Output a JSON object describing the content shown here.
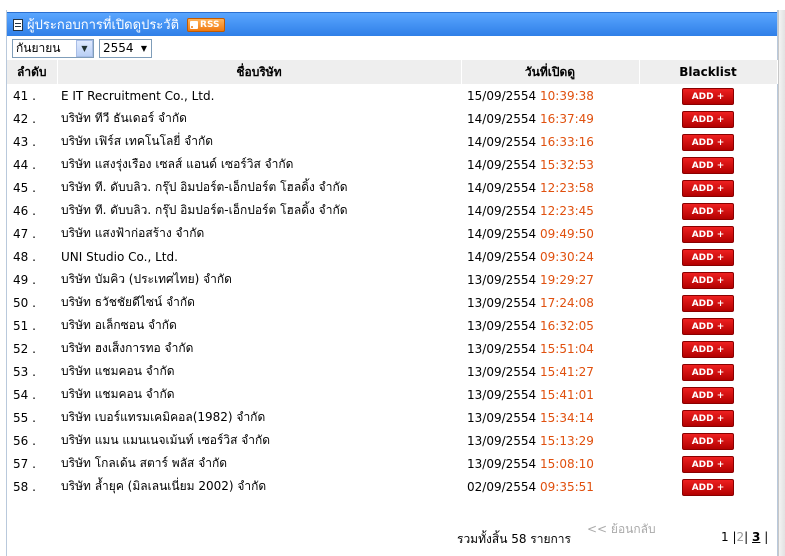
{
  "header": {
    "title": "ผู้ประกอบการที่เปิดดูประวัติ",
    "rss_label": "RSS"
  },
  "filters": {
    "month": "กันยายน",
    "year": "2554"
  },
  "table": {
    "columns": [
      "ลำดับ",
      "ชื่อบริษัท",
      "วันที่เปิดดู",
      "Blacklist"
    ],
    "add_label": "ADD +",
    "rows": [
      {
        "no": "41 .",
        "company": "E IT Recruitment Co., Ltd.",
        "date": "15/09/2554",
        "time": "10:39:38"
      },
      {
        "no": "42 .",
        "company": "บริษัท ทีวี ธันเดอร์ จำกัด",
        "date": "14/09/2554",
        "time": "16:37:49"
      },
      {
        "no": "43 .",
        "company": "บริษัท เฟิร์ส เทคโนโลยี่ จำกัด",
        "date": "14/09/2554",
        "time": "16:33:16"
      },
      {
        "no": "44 .",
        "company": "บริษัท แสงรุ่งเรือง เซลส์ แอนด์ เซอร์วิส จำกัด",
        "date": "14/09/2554",
        "time": "15:32:53"
      },
      {
        "no": "45 .",
        "company": "บริษัท ที. ดับบลิว. กรุ๊ป อิมปอร์ต-เอ็กปอร์ต โฮลดิ้ง จำกัด",
        "date": "14/09/2554",
        "time": "12:23:58"
      },
      {
        "no": "46 .",
        "company": "บริษัท ที. ดับบลิว. กรุ๊ป อิมปอร์ต-เอ็กปอร์ต โฮลดิ้ง จำกัด",
        "date": "14/09/2554",
        "time": "12:23:45"
      },
      {
        "no": "47 .",
        "company": "บริษัท แสงฟ้าก่อสร้าง จำกัด",
        "date": "14/09/2554",
        "time": "09:49:50"
      },
      {
        "no": "48 .",
        "company": "UNI Studio Co., Ltd.",
        "date": "14/09/2554",
        "time": "09:30:24"
      },
      {
        "no": "49 .",
        "company": "บริษัท บัมคิว (ประเทศไทย) จำกัด",
        "date": "13/09/2554",
        "time": "19:29:27"
      },
      {
        "no": "50 .",
        "company": "บริษัท ธวัชชัยดีไซน์ จำกัด",
        "date": "13/09/2554",
        "time": "17:24:08"
      },
      {
        "no": "51 .",
        "company": "บริษัท อเล็กซอน จำกัด",
        "date": "13/09/2554",
        "time": "16:32:05"
      },
      {
        "no": "52 .",
        "company": "บริษัท ฮงเส็งการทอ จำกัด",
        "date": "13/09/2554",
        "time": "15:51:04"
      },
      {
        "no": "53 .",
        "company": "บริษัท แชมคอน จำกัด",
        "date": "13/09/2554",
        "time": "15:41:27"
      },
      {
        "no": "54 .",
        "company": "บริษัท แชมคอน จำกัด",
        "date": "13/09/2554",
        "time": "15:41:01"
      },
      {
        "no": "55 .",
        "company": "บริษัท เบอร์แทรมเคมิคอล(1982) จำกัด",
        "date": "13/09/2554",
        "time": "15:34:14"
      },
      {
        "no": "56 .",
        "company": "บริษัท แมน แมนเนจเม้นท์ เซอร์วิส จำกัด",
        "date": "13/09/2554",
        "time": "15:13:29"
      },
      {
        "no": "57 .",
        "company": "บริษัท โกลเด้น สตาร์ พลัส จำกัด",
        "date": "13/09/2554",
        "time": "15:08:10"
      },
      {
        "no": "58 .",
        "company": "บริษัท ล้ำยุค (มิลเลนเนี่ยม 2002) จำกัด",
        "date": "02/09/2554",
        "time": "09:35:51"
      }
    ]
  },
  "footer": {
    "total": "รวมทั้งสิ้น 58 รายการ",
    "back": "<< ย้อนกลับ",
    "pages": [
      "1",
      "2",
      "3"
    ],
    "current_page": "3"
  },
  "colors": {
    "time": "#e0500e",
    "header_bar": "#3b8cf0",
    "add_button": "#d40000"
  }
}
